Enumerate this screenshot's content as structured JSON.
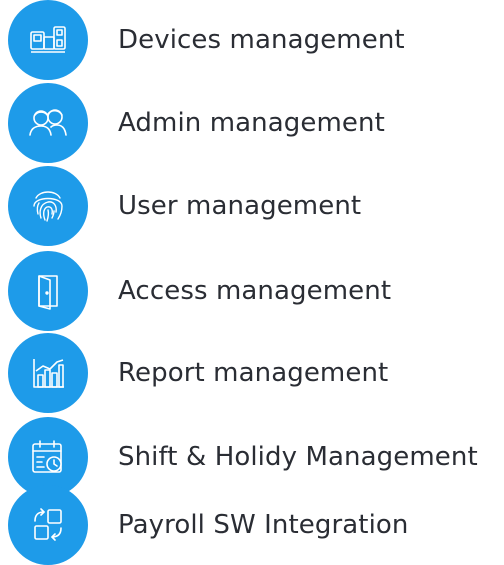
{
  "accent_color": "#1e9be9",
  "text_color": "#2a2d34",
  "features": [
    {
      "label": "Devices management",
      "icon": "devices-icon"
    },
    {
      "label": "Admin management",
      "icon": "admins-icon"
    },
    {
      "label": "User management",
      "icon": "fingerprint-icon"
    },
    {
      "label": "Access management",
      "icon": "door-icon"
    },
    {
      "label": "Report management",
      "icon": "report-chart-icon"
    },
    {
      "label": "Shift & Holidy Management",
      "icon": "calendar-clock-icon"
    },
    {
      "label": "Payroll SW Integration",
      "icon": "integration-icon"
    }
  ]
}
